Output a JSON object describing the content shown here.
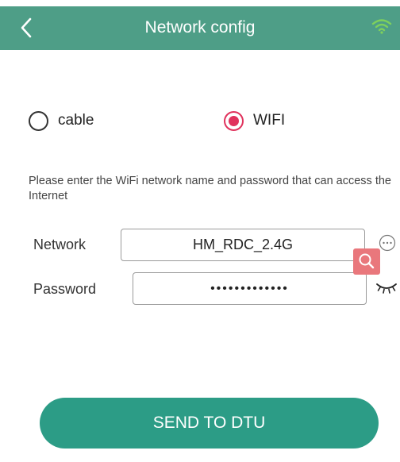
{
  "header": {
    "title": "Network config",
    "back_icon": "chevron-left-icon",
    "status_icon": "wifi-icon",
    "background_color": "#4e9e87"
  },
  "connection_type": {
    "options": [
      {
        "label": "cable",
        "selected": false
      },
      {
        "label": "WIFI",
        "selected": true
      }
    ],
    "selected_color": "#e0325c"
  },
  "instructions": "Please enter the WiFi network name and password that can access the Internet",
  "form": {
    "network_label": "Network",
    "network_value": "HM_RDC_2.4G",
    "password_label": "Password",
    "password_value": "•••••••••••••",
    "more_icon": "more-icon",
    "search_icon": "search-icon",
    "eye_icon": "eye-closed-icon"
  },
  "send_button": {
    "label": "SEND TO DTU",
    "color": "#2c9c86"
  }
}
